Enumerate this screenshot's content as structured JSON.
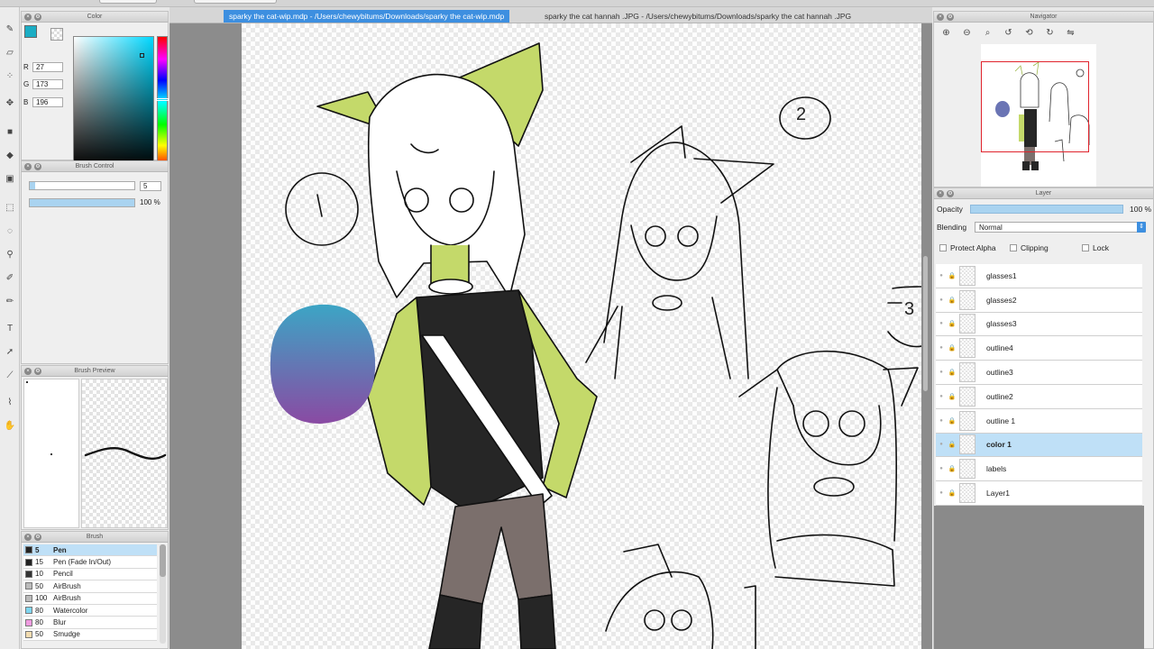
{
  "tabs": [
    {
      "label": "sparky the cat-wip.mdp - /Users/chewybitums/Downloads/sparky the cat-wip.mdp",
      "active": true
    },
    {
      "label": "sparky the cat hannah .JPG - /Users/chewybitums/Downloads/sparky the cat hannah .JPG",
      "active": false
    }
  ],
  "tools": [
    "pen-tool-icon",
    "eraser-tool-icon",
    "dot-tool-icon",
    "move-tool-icon",
    "fill-tool-icon",
    "bucket-tool-icon",
    "gradient-tool-icon",
    "select-rect-icon",
    "lasso-icon",
    "magic-wand-icon",
    "select-pen-icon",
    "select-eraser-icon",
    "text-tool-icon",
    "operation-tool-icon",
    "divide-tool-icon",
    "eyedropper-icon",
    "hand-tool-icon"
  ],
  "color_panel": {
    "title": "Color",
    "r_label": "R",
    "g_label": "G",
    "b_label": "B",
    "r": "27",
    "g": "173",
    "b": "196",
    "fg": "#1badc4",
    "bg": "#e0338a"
  },
  "brush_control": {
    "title": "Brush Control",
    "size": "5",
    "opacity": "100 %",
    "size_fraction": 0.05,
    "opacity_fraction": 1.0
  },
  "brush_preview": {
    "title": "Brush Preview"
  },
  "brush": {
    "title": "Brush",
    "items": [
      {
        "size": "5",
        "name": "Pen",
        "color": "#222222",
        "selected": true
      },
      {
        "size": "15",
        "name": "Pen (Fade In/Out)",
        "color": "#222222",
        "selected": false
      },
      {
        "size": "10",
        "name": "Pencil",
        "color": "#333333",
        "selected": false
      },
      {
        "size": "50",
        "name": "AirBrush",
        "color": "#bbbbbb",
        "selected": false
      },
      {
        "size": "100",
        "name": "AirBrush",
        "color": "#bbbbbb",
        "selected": false
      },
      {
        "size": "80",
        "name": "Watercolor",
        "color": "#7fd6f0",
        "selected": false
      },
      {
        "size": "80",
        "name": "Blur",
        "color": "#f09be0",
        "selected": false
      },
      {
        "size": "50",
        "name": "Smudge",
        "color": "#f3dcb0",
        "selected": false
      }
    ]
  },
  "canvas_labels": {
    "two": "2",
    "three": "3"
  },
  "navigator": {
    "title": "Navigator"
  },
  "layer_panel": {
    "title": "Layer",
    "opacity_label": "Opacity",
    "opacity_value": "100 %",
    "blending_label": "Blending",
    "blending_value": "Normal",
    "protect_alpha": "Protect Alpha",
    "clipping": "Clipping",
    "lock": "Lock",
    "layers": [
      {
        "name": "glasses1",
        "selected": false
      },
      {
        "name": "glasses2",
        "selected": false
      },
      {
        "name": "glasses3",
        "selected": false
      },
      {
        "name": "outline4",
        "selected": false
      },
      {
        "name": "outline3",
        "selected": false
      },
      {
        "name": "outline2",
        "selected": false
      },
      {
        "name": "outline 1",
        "selected": false
      },
      {
        "name": "color 1",
        "selected": true
      },
      {
        "name": "labels",
        "selected": false
      },
      {
        "name": "Layer1",
        "selected": false
      }
    ]
  },
  "colors": {
    "accent": "#3d8fe0",
    "selection": "#bfe0f7",
    "character_green": "#c4d96a",
    "pants": "#7b6f6c",
    "shirt": "#262626"
  }
}
